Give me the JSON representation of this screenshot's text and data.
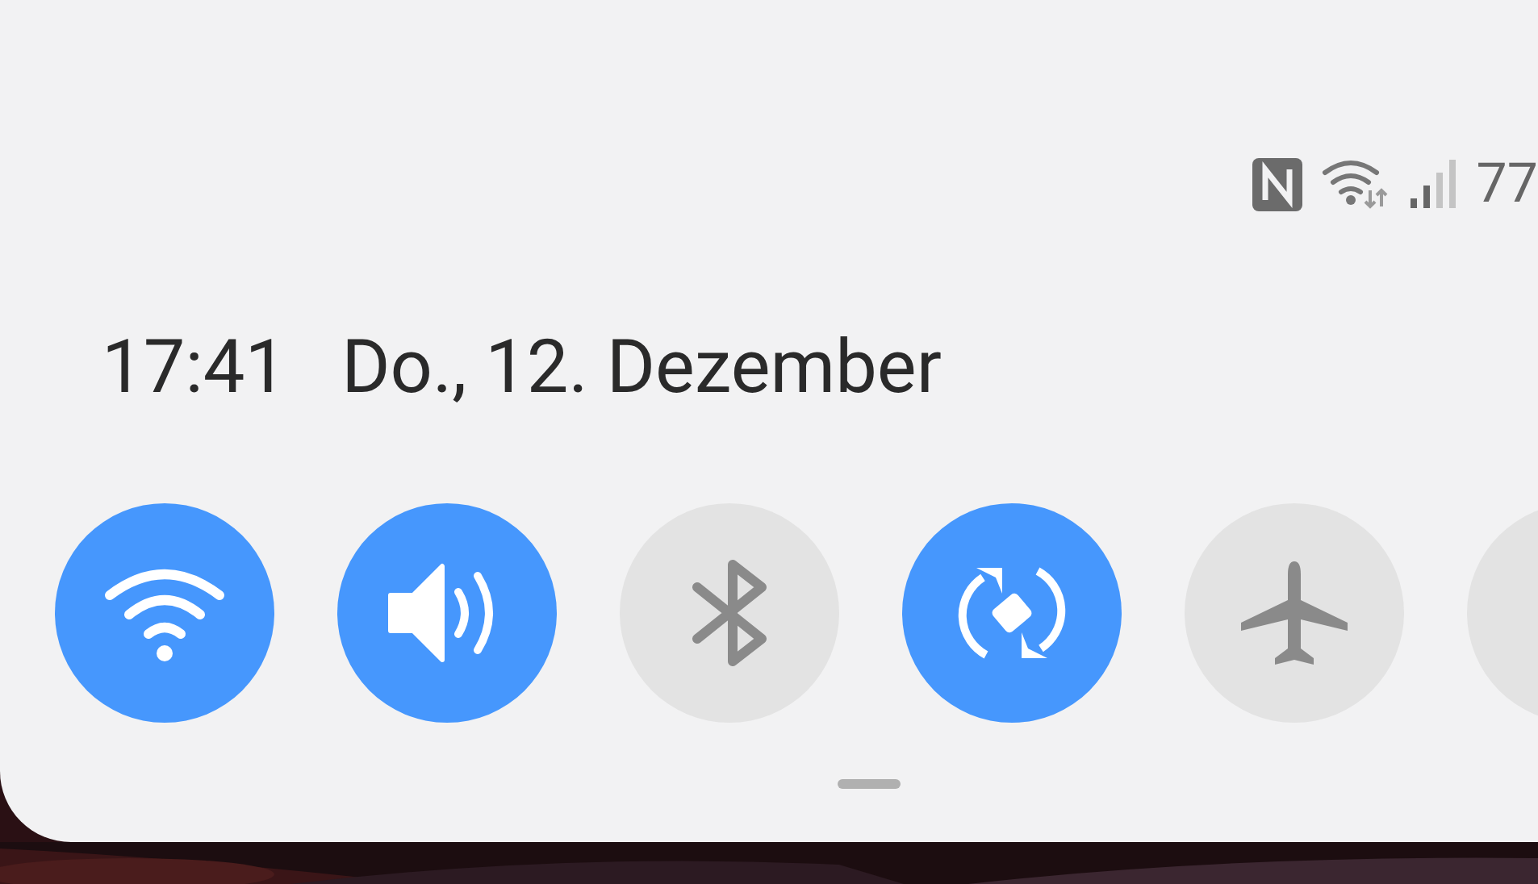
{
  "status_bar": {
    "battery": "77"
  },
  "clock": {
    "time": "17:41",
    "date": "Do., 12. Dezember"
  },
  "tiles": [
    {
      "kind": "wifi",
      "on": true
    },
    {
      "kind": "sound",
      "on": true
    },
    {
      "kind": "bluetooth",
      "on": false
    },
    {
      "kind": "rotation",
      "on": true
    },
    {
      "kind": "airplane",
      "on": false
    },
    {
      "kind": "hidden",
      "on": false
    }
  ]
}
